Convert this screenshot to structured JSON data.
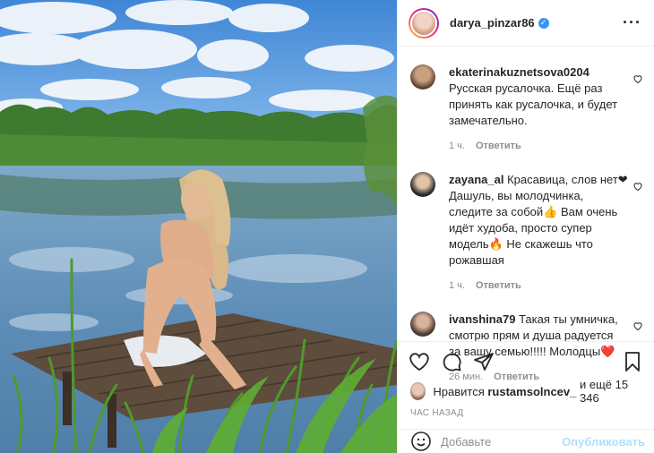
{
  "post": {
    "username": "darya_pinzar86",
    "verified_mark": "✓",
    "more_icon": "more-options-icon"
  },
  "comments": [
    {
      "user": "ekaterinakuznetsova0204",
      "text": "Русская русалочка. Ещё раз принять как русалочка, и будет замечательно.",
      "time": "1 ч.",
      "reply": "Ответить"
    },
    {
      "user": "zayana_al",
      "text": "Красавица, слов нет❤ Дашуль, вы молодчинка, следите за собой👍 Вам очень идёт худоба, просто супер модель🔥 Не скажешь что рожавшая",
      "time": "1 ч.",
      "reply": "Ответить"
    },
    {
      "user": "ivanshina79",
      "text": "Такая ты умничка, смотрю прям и душа радуется за вашу семью!!!!! Молодцы❤️",
      "time": "26 мин.",
      "reply": "Ответить"
    }
  ],
  "likes": {
    "prefix": "Нравится",
    "user": "rustamsolncev_",
    "suffix": "и ещё 15 346"
  },
  "timestamp": "ЧАС НАЗАД",
  "add_comment": {
    "placeholder": "Добавьте",
    "post_label": "Опубликовать"
  },
  "colors": {
    "verified": "#3897f0",
    "post_button": "#b2dffc",
    "heart_red": "#ed4956"
  }
}
